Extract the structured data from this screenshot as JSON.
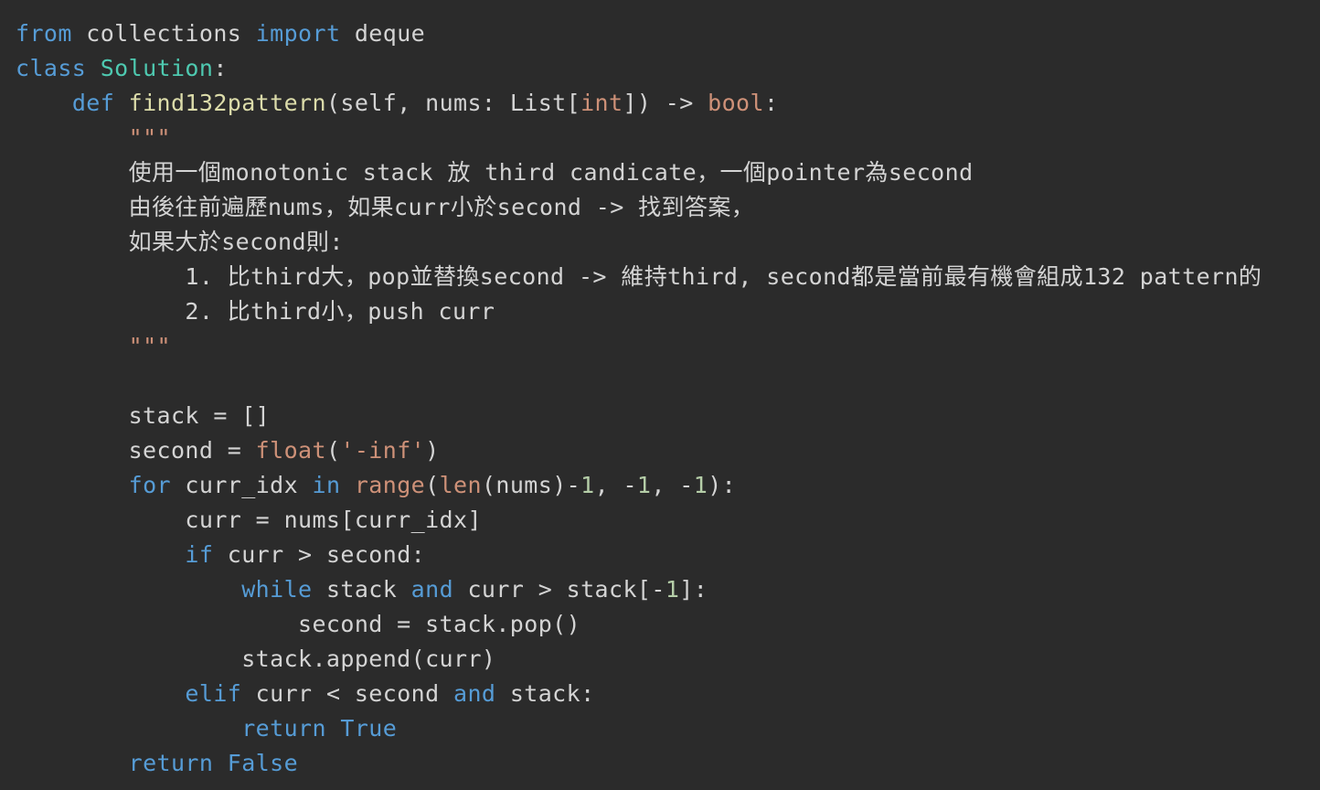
{
  "colors": {
    "background": "#2b2b2b",
    "plain": "#d4d4d4",
    "keyword": "#569cd6",
    "class_name": "#4ec9b0",
    "function_name": "#dcdcaa",
    "builtin_type": "#ce9178",
    "string": "#ce9178",
    "number": "#b5cea8"
  },
  "code_lines": [
    [
      [
        "kw",
        "from"
      ],
      [
        "plain",
        " collections "
      ],
      [
        "kw",
        "import"
      ],
      [
        "plain",
        " deque"
      ]
    ],
    [
      [
        "kw",
        "class"
      ],
      [
        "plain",
        " "
      ],
      [
        "class",
        "Solution"
      ],
      [
        "plain",
        ":"
      ]
    ],
    [
      [
        "plain",
        "    "
      ],
      [
        "kw",
        "def"
      ],
      [
        "plain",
        " "
      ],
      [
        "fn",
        "find132pattern"
      ],
      [
        "plain",
        "(self, nums: List["
      ],
      [
        "type",
        "int"
      ],
      [
        "plain",
        "]) -> "
      ],
      [
        "type",
        "bool"
      ],
      [
        "plain",
        ":"
      ]
    ],
    [
      [
        "plain",
        "        "
      ],
      [
        "str",
        "\"\"\""
      ]
    ],
    [
      [
        "plain",
        "        "
      ],
      [
        "doc",
        "使用一個monotonic stack 放 third candicate，一個pointer為second"
      ]
    ],
    [
      [
        "plain",
        "        "
      ],
      [
        "doc",
        "由後往前遍歷nums，如果curr小於second -> 找到答案，"
      ]
    ],
    [
      [
        "plain",
        "        "
      ],
      [
        "doc",
        "如果大於second則:"
      ]
    ],
    [
      [
        "plain",
        "            "
      ],
      [
        "doc",
        "1. 比third大，pop並替換second -> 維持third, second都是當前最有機會組成132 pattern的"
      ]
    ],
    [
      [
        "plain",
        "            "
      ],
      [
        "doc",
        "2. 比third小，push curr"
      ]
    ],
    [
      [
        "plain",
        "        "
      ],
      [
        "str",
        "\"\"\""
      ]
    ],
    [
      [
        "plain",
        ""
      ]
    ],
    [
      [
        "plain",
        "        stack = []"
      ]
    ],
    [
      [
        "plain",
        "        second = "
      ],
      [
        "type",
        "float"
      ],
      [
        "plain",
        "("
      ],
      [
        "str",
        "'-inf'"
      ],
      [
        "plain",
        ")"
      ]
    ],
    [
      [
        "plain",
        "        "
      ],
      [
        "kw",
        "for"
      ],
      [
        "plain",
        " curr_idx "
      ],
      [
        "kw",
        "in"
      ],
      [
        "plain",
        " "
      ],
      [
        "type",
        "range"
      ],
      [
        "plain",
        "("
      ],
      [
        "type",
        "len"
      ],
      [
        "plain",
        "(nums)-"
      ],
      [
        "num",
        "1"
      ],
      [
        "plain",
        ", -"
      ],
      [
        "num",
        "1"
      ],
      [
        "plain",
        ", -"
      ],
      [
        "num",
        "1"
      ],
      [
        "plain",
        "):"
      ]
    ],
    [
      [
        "plain",
        "            curr = nums[curr_idx]"
      ]
    ],
    [
      [
        "plain",
        "            "
      ],
      [
        "kw",
        "if"
      ],
      [
        "plain",
        " curr > second:"
      ]
    ],
    [
      [
        "plain",
        "                "
      ],
      [
        "kw",
        "while"
      ],
      [
        "plain",
        " stack "
      ],
      [
        "kw",
        "and"
      ],
      [
        "plain",
        " curr > stack[-"
      ],
      [
        "num",
        "1"
      ],
      [
        "plain",
        "]:"
      ]
    ],
    [
      [
        "plain",
        "                    second = stack.pop()"
      ]
    ],
    [
      [
        "plain",
        "                stack.append(curr)"
      ]
    ],
    [
      [
        "plain",
        "            "
      ],
      [
        "kw",
        "elif"
      ],
      [
        "plain",
        " curr < second "
      ],
      [
        "kw",
        "and"
      ],
      [
        "plain",
        " stack:"
      ]
    ],
    [
      [
        "plain",
        "                "
      ],
      [
        "kw",
        "return"
      ],
      [
        "plain",
        " "
      ],
      [
        "kw",
        "True"
      ]
    ],
    [
      [
        "plain",
        "        "
      ],
      [
        "kw",
        "return"
      ],
      [
        "plain",
        " "
      ],
      [
        "kw",
        "False"
      ]
    ]
  ]
}
